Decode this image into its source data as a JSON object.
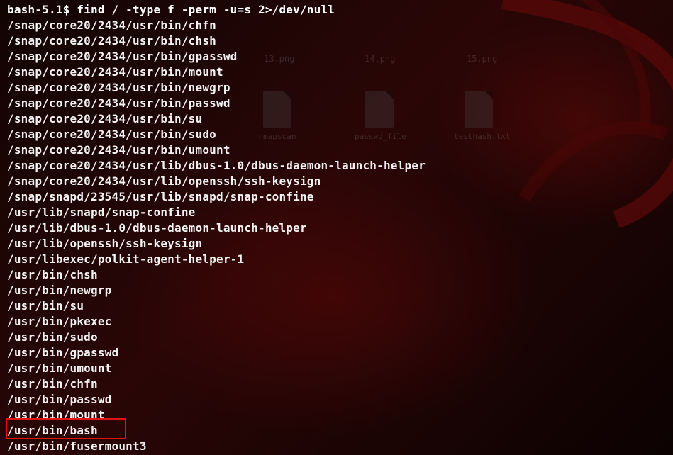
{
  "terminal": {
    "prompt": "bash-5.1$ find / -type f -perm -u=s 2>/dev/null",
    "output": [
      "/snap/core20/2434/usr/bin/chfn",
      "/snap/core20/2434/usr/bin/chsh",
      "/snap/core20/2434/usr/bin/gpasswd",
      "/snap/core20/2434/usr/bin/mount",
      "/snap/core20/2434/usr/bin/newgrp",
      "/snap/core20/2434/usr/bin/passwd",
      "/snap/core20/2434/usr/bin/su",
      "/snap/core20/2434/usr/bin/sudo",
      "/snap/core20/2434/usr/bin/umount",
      "/snap/core20/2434/usr/lib/dbus-1.0/dbus-daemon-launch-helper",
      "/snap/core20/2434/usr/lib/openssh/ssh-keysign",
      "/snap/snapd/23545/usr/lib/snapd/snap-confine",
      "/usr/lib/snapd/snap-confine",
      "/usr/lib/dbus-1.0/dbus-daemon-launch-helper",
      "/usr/lib/openssh/ssh-keysign",
      "/usr/libexec/polkit-agent-helper-1",
      "/usr/bin/chsh",
      "/usr/bin/newgrp",
      "/usr/bin/su",
      "/usr/bin/pkexec",
      "/usr/bin/sudo",
      "/usr/bin/gpasswd",
      "/usr/bin/umount",
      "/usr/bin/chfn",
      "/usr/bin/passwd",
      "/usr/bin/mount",
      "/usr/bin/bash",
      "/usr/bin/fusermount3"
    ]
  },
  "desktop": {
    "top_labels": [
      "13.png",
      "14.png",
      "15.png"
    ],
    "icons": [
      "nmapscan",
      "passwd_file",
      "testhash.txt"
    ]
  },
  "colors": {
    "highlight": "#e01414",
    "text": "#f2f2f2",
    "background": "#0b0404"
  }
}
